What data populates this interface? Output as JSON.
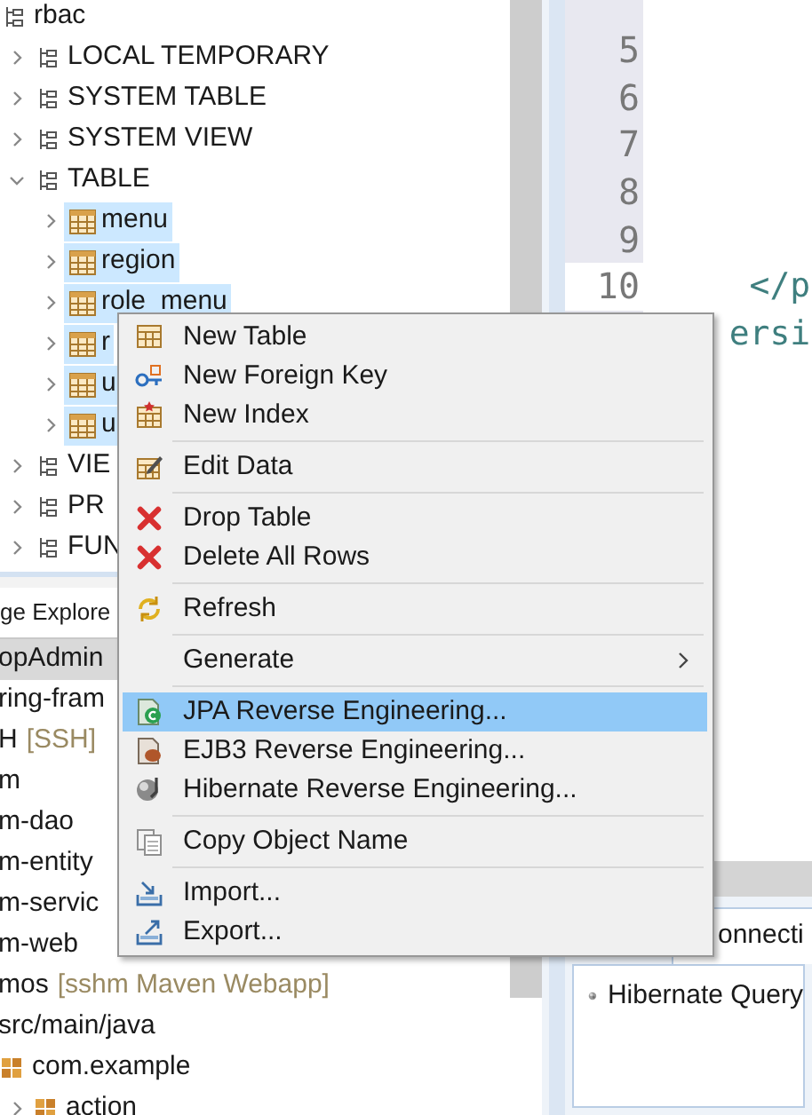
{
  "database_tree": [
    {
      "label": "rbac",
      "kind": "folder",
      "selected": false,
      "children": [
        {
          "label": "LOCAL TEMPORARY",
          "kind": "folder",
          "expanded": false,
          "selected": false
        },
        {
          "label": "SYSTEM TABLE",
          "kind": "folder",
          "expanded": false,
          "selected": false
        },
        {
          "label": "SYSTEM VIEW",
          "kind": "folder",
          "expanded": false,
          "selected": false
        },
        {
          "label": "TABLE",
          "kind": "folder",
          "expanded": true,
          "selected": false,
          "children": [
            {
              "label": "menu",
              "kind": "table",
              "expanded": false,
              "selected": true
            },
            {
              "label": "region",
              "kind": "table",
              "expanded": false,
              "selected": true
            },
            {
              "label": "role_menu",
              "kind": "table",
              "expanded": false,
              "selected": true
            },
            {
              "label": "r",
              "kind": "table",
              "expanded": false,
              "selected": true
            },
            {
              "label": "u",
              "kind": "table",
              "expanded": false,
              "selected": true
            },
            {
              "label": "u",
              "kind": "table",
              "expanded": false,
              "selected": true
            }
          ]
        },
        {
          "label": "VIE",
          "kind": "folder",
          "expanded": false,
          "selected": false
        },
        {
          "label": "PR",
          "kind": "folder",
          "expanded": false,
          "selected": false
        },
        {
          "label": "FUN",
          "kind": "folder",
          "expanded": false,
          "selected": false
        }
      ]
    }
  ],
  "package_explorer": {
    "tab": "ge Explore",
    "items": [
      {
        "label": "opAdmin",
        "selected": true
      },
      {
        "label": "ring-fram",
        "selected": false
      },
      {
        "label": "H",
        "decoration": "[SSH]",
        "selected": false
      },
      {
        "label": "m",
        "selected": false
      },
      {
        "label": "m-dao",
        "selected": false
      },
      {
        "label": "m-entity",
        "selected": false
      },
      {
        "label": "m-servic",
        "selected": false
      },
      {
        "label": "m-web",
        "selected": false
      },
      {
        "label": "mos",
        "decoration": "[sshm Maven Webapp]",
        "selected": false
      },
      {
        "label": "src/main/java",
        "selected": false,
        "children": [
          {
            "label": "com.example",
            "kind": "package",
            "selected": false,
            "children": [
              {
                "label": "action",
                "kind": "package",
                "expanded": false,
                "selected": false
              }
            ]
          }
        ]
      }
    ]
  },
  "editor": {
    "lines": [
      {
        "current": false
      },
      {
        "number": "5",
        "current": false
      },
      {
        "number": "6",
        "current": false
      },
      {
        "number": "7",
        "current": false
      },
      {
        "number": "8",
        "current": false
      },
      {
        "number": "9",
        "current": false
      },
      {
        "number": "10",
        "current": true,
        "code": "    </p"
      },
      {
        "code": "   ersi"
      }
    ]
  },
  "bottom_panel": {
    "tab": "onnecti",
    "view_title": "Hibernate Query"
  },
  "context_menu": {
    "groups": [
      [
        {
          "label": "New Table",
          "submenu": false,
          "selected": false
        },
        {
          "label": "New Foreign Key",
          "submenu": false,
          "selected": false
        },
        {
          "label": "New Index",
          "submenu": false,
          "selected": false
        }
      ],
      [
        {
          "label": "Edit Data",
          "submenu": false,
          "selected": false
        }
      ],
      [
        {
          "label": "Drop Table",
          "submenu": false,
          "selected": false
        },
        {
          "label": "Delete All Rows",
          "submenu": false,
          "selected": false
        }
      ],
      [
        {
          "label": "Refresh",
          "submenu": false,
          "selected": false
        }
      ],
      [
        {
          "label": "Generate",
          "submenu": true,
          "selected": false
        }
      ],
      [
        {
          "label": "JPA Reverse Engineering...",
          "submenu": false,
          "selected": true
        },
        {
          "label": "EJB3 Reverse Engineering...",
          "submenu": false,
          "selected": false
        },
        {
          "label": "Hibernate Reverse Engineering...",
          "submenu": false,
          "selected": false
        }
      ],
      [
        {
          "label": "Copy Object Name",
          "submenu": false,
          "selected": false
        }
      ],
      [
        {
          "label": "Import...",
          "submenu": false,
          "selected": false
        },
        {
          "label": "Export...",
          "submenu": false,
          "selected": false
        }
      ]
    ]
  }
}
